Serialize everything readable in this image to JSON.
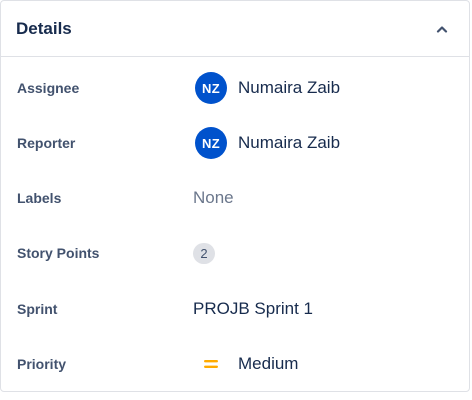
{
  "details": {
    "title": "Details",
    "collapse_icon": "chevron-up-icon"
  },
  "fields": {
    "assignee": {
      "label": "Assignee",
      "initials": "NZ",
      "name": "Numaira Zaib",
      "avatar_color": "#0052cc"
    },
    "reporter": {
      "label": "Reporter",
      "initials": "NZ",
      "name": "Numaira Zaib",
      "avatar_color": "#0052cc"
    },
    "labels": {
      "label": "Labels",
      "value": "None"
    },
    "story_points": {
      "label": "Story Points",
      "value": "2"
    },
    "sprint": {
      "label": "Sprint",
      "value": "PROJB Sprint 1"
    },
    "priority": {
      "label": "Priority",
      "value": "Medium",
      "icon": "priority-medium-icon",
      "icon_color": "#ffab00"
    }
  }
}
